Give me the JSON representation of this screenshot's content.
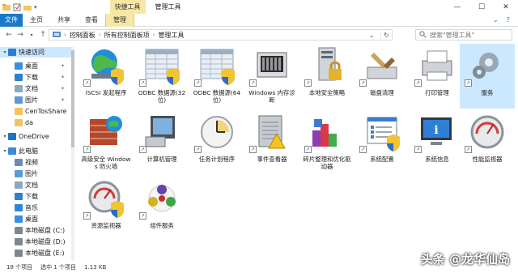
{
  "window": {
    "context_tab": "快捷工具",
    "title": "管理工具",
    "minimize": "—",
    "maximize": "☐",
    "close": "✕"
  },
  "ribbon": {
    "file": "文件",
    "tabs": [
      "主页",
      "共享",
      "查看",
      "管理"
    ],
    "active_tab": "管理"
  },
  "address": {
    "segments": [
      "控制面板",
      "所有控制面板项",
      "管理工具"
    ],
    "search_placeholder": "搜索\"管理工具\""
  },
  "sidebar": {
    "items": [
      {
        "label": "快速访问",
        "icon": "star-icon",
        "pinned": false,
        "selected": true,
        "level": 0,
        "color": "#2b7bd6"
      },
      {
        "label": "桌面",
        "icon": "desktop-icon",
        "pinned": true,
        "level": 1,
        "color": "#3c8ddf"
      },
      {
        "label": "下载",
        "icon": "download-icon",
        "pinned": true,
        "level": 1,
        "color": "#2d7fd3"
      },
      {
        "label": "文档",
        "icon": "documents-icon",
        "pinned": true,
        "level": 1,
        "color": "#8ea6c0"
      },
      {
        "label": "图片",
        "icon": "pictures-icon",
        "pinned": true,
        "level": 1,
        "color": "#5b9bd5"
      },
      {
        "label": "CenTosShare",
        "icon": "folder-icon",
        "pinned": false,
        "level": 1,
        "color": "#f2c55c"
      },
      {
        "label": "da",
        "icon": "folder-icon",
        "pinned": false,
        "level": 1,
        "color": "#f2c55c"
      },
      {
        "label": "OneDrive",
        "icon": "onedrive-icon",
        "pinned": false,
        "level": 0,
        "color": "#1e72c8"
      },
      {
        "label": "此电脑",
        "icon": "computer-icon",
        "pinned": false,
        "level": 0,
        "color": "#3e8ad8"
      },
      {
        "label": "视频",
        "icon": "videos-icon",
        "pinned": false,
        "level": 1,
        "color": "#6d8ab1"
      },
      {
        "label": "图片",
        "icon": "pictures-icon",
        "pinned": false,
        "level": 1,
        "color": "#5b9bd5"
      },
      {
        "label": "文档",
        "icon": "documents-icon",
        "pinned": false,
        "level": 1,
        "color": "#8ea6c0"
      },
      {
        "label": "下载",
        "icon": "download-icon",
        "pinned": false,
        "level": 1,
        "color": "#2d7fd3"
      },
      {
        "label": "音乐",
        "icon": "music-icon",
        "pinned": false,
        "level": 1,
        "color": "#2b87d8"
      },
      {
        "label": "桌面",
        "icon": "desktop-icon",
        "pinned": false,
        "level": 1,
        "color": "#3c8ddf"
      },
      {
        "label": "本地磁盘 (C:)",
        "icon": "drive-icon",
        "pinned": false,
        "level": 1,
        "color": "#7d8790"
      },
      {
        "label": "本地磁盘 (D:)",
        "icon": "drive-icon",
        "pinned": false,
        "level": 1,
        "color": "#7d8790"
      },
      {
        "label": "本地磁盘 (E:)",
        "icon": "drive-icon",
        "pinned": false,
        "level": 1,
        "color": "#7d8790"
      }
    ]
  },
  "items": [
    {
      "label": "iSCSI 发起程序",
      "icon": "iscsi-globe-icon",
      "shortcut": "↗"
    },
    {
      "label": "ODBC 数据源(32 位)",
      "icon": "odbc-table-icon",
      "shortcut": "↗"
    },
    {
      "label": "ODBC 数据源(64 位)",
      "icon": "odbc-table-icon",
      "shortcut": "↗"
    },
    {
      "label": "Windows 内存诊断",
      "icon": "memory-diagnostic-icon",
      "shortcut": "↗"
    },
    {
      "label": "本地安全策略",
      "icon": "local-security-policy-icon",
      "shortcut": "↗"
    },
    {
      "label": "磁盘清理",
      "icon": "disk-cleanup-icon",
      "shortcut": "↗"
    },
    {
      "label": "打印管理",
      "icon": "print-management-icon",
      "shortcut": "↗"
    },
    {
      "label": "服务",
      "icon": "services-gear-icon",
      "shortcut": "↗",
      "selected": true
    },
    {
      "label": "高级安全 Windows 防火墙",
      "icon": "firewall-icon",
      "shortcut": "↗"
    },
    {
      "label": "计算机管理",
      "icon": "computer-management-icon",
      "shortcut": "↗"
    },
    {
      "label": "任务计划程序",
      "icon": "task-scheduler-clock-icon",
      "shortcut": "↗"
    },
    {
      "label": "事件查看器",
      "icon": "event-viewer-icon",
      "shortcut": "↗"
    },
    {
      "label": "碎片整理和优化驱动器",
      "icon": "defragment-icon",
      "shortcut": "↗"
    },
    {
      "label": "系统配置",
      "icon": "system-configuration-icon",
      "shortcut": "↗"
    },
    {
      "label": "系统信息",
      "icon": "system-information-icon",
      "shortcut": "↗"
    },
    {
      "label": "性能监视器",
      "icon": "performance-monitor-icon",
      "shortcut": "↗"
    },
    {
      "label": "资源监视器",
      "icon": "resource-monitor-icon",
      "shortcut": "↗"
    },
    {
      "label": "组件服务",
      "icon": "component-services-icon",
      "shortcut": "↗"
    }
  ],
  "status": {
    "count": "18 个项目",
    "selected": "选中 1 个项目",
    "size": "1.13 KB"
  },
  "watermark": "头条 @龙华仙岛",
  "colors": {
    "file_tab": "#1979ca",
    "context_tab": "#f6e7a4",
    "selection": "#cce8ff"
  }
}
